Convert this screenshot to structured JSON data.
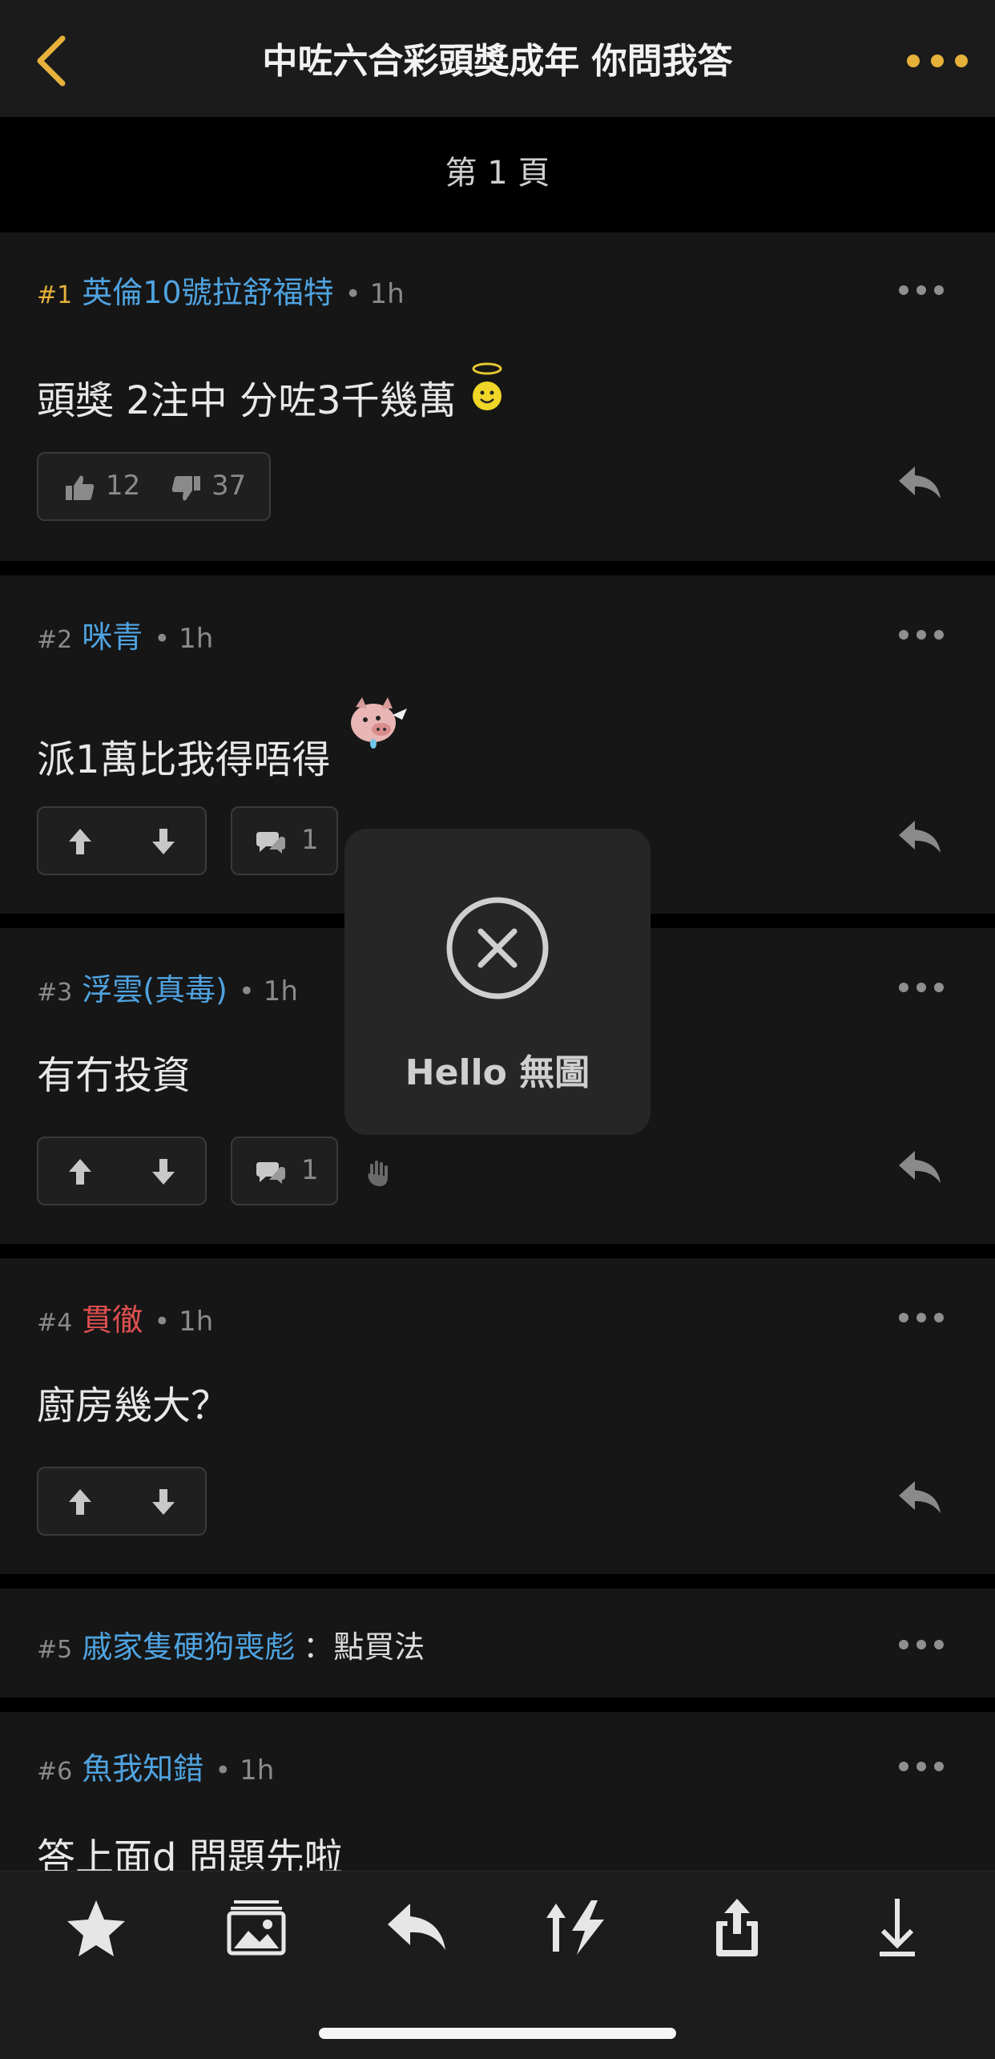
{
  "header": {
    "title": "中咗六合彩頭獎成年 你問我答"
  },
  "page_indicator": "第 1 頁",
  "posts": [
    {
      "num": "#1",
      "user": "英倫10號拉舒福特",
      "time": "• 1h",
      "text": "頭獎 2注中 分咗3千幾萬",
      "likes": "12",
      "dislikes": "37"
    },
    {
      "num": "#2",
      "user": "咪青",
      "time": "• 1h",
      "text": "派1萬比我得唔得",
      "replies": "1"
    },
    {
      "num": "#3",
      "user": "浮雲(真毒)",
      "time": "• 1h",
      "text": "有冇投資",
      "replies": "1"
    },
    {
      "num": "#4",
      "user": "貫徹",
      "time": "• 1h",
      "text": "廚房幾大？"
    },
    {
      "num": "#5",
      "user": "戚家隻硬狗喪彪",
      "inline": "：點買法"
    },
    {
      "num": "#6",
      "user": "魚我知錯",
      "time": "• 1h",
      "text": "答上面d 問題先啦"
    }
  ],
  "toast": {
    "text": "Hello 無圖"
  },
  "colors": {
    "accent": "#e5b13b",
    "username": "#4fa3e0",
    "username_alt": "#e05050",
    "background": "#000000",
    "card": "#161616"
  },
  "icons": [
    "back-chevron-icon",
    "more-icon",
    "thumbs-up-icon",
    "thumbs-down-icon",
    "up-arrow-icon",
    "down-arrow-icon",
    "comment-icon",
    "reply-icon",
    "hand-icon",
    "star-icon",
    "gallery-icon",
    "lightning-sort-icon",
    "share-icon",
    "download-icon",
    "close-circle-icon"
  ]
}
